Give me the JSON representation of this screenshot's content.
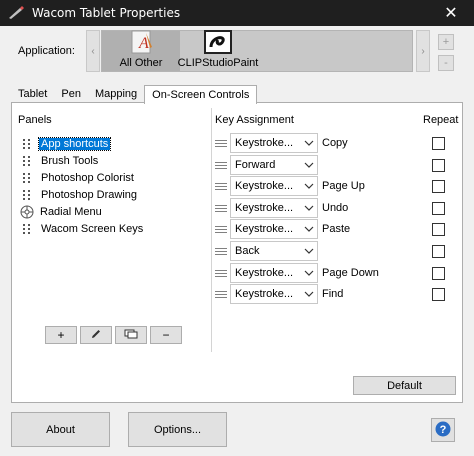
{
  "window": {
    "title": "Wacom Tablet Properties",
    "close_glyph": "✕"
  },
  "application": {
    "label": "Application:",
    "scroll_left_glyph": "‹",
    "scroll_right_glyph": "›",
    "tiles": [
      {
        "label": "All Other",
        "icon": "all-other-icon"
      },
      {
        "label": "CLIPStudioPaint",
        "icon": "clip-studio-icon"
      }
    ],
    "add_glyph": "+",
    "remove_glyph": "-"
  },
  "tabs": [
    {
      "label": "Tablet"
    },
    {
      "label": "Pen"
    },
    {
      "label": "Mapping"
    },
    {
      "label": "On-Screen Controls",
      "active": true
    }
  ],
  "panels": {
    "title": "Panels",
    "items": [
      {
        "label": "App shortcuts",
        "selected": true
      },
      {
        "label": "Brush Tools"
      },
      {
        "label": "Photoshop Colorist"
      },
      {
        "label": "Photoshop Drawing"
      },
      {
        "label": "Radial Menu",
        "icon": "radial-menu-icon"
      },
      {
        "label": "Wacom Screen Keys"
      }
    ],
    "toolbar": {
      "add": "+",
      "remove": "−"
    }
  },
  "key_assignment": {
    "title": "Key Assignment",
    "repeat_title": "Repeat",
    "rows": [
      {
        "type": "Keystroke...",
        "value": "Copy",
        "repeat": false
      },
      {
        "type": "Forward",
        "value": "",
        "repeat": false
      },
      {
        "type": "Keystroke...",
        "value": "Page Up",
        "repeat": false
      },
      {
        "type": "Keystroke...",
        "value": "Undo",
        "repeat": false
      },
      {
        "type": "Keystroke...",
        "value": "Paste",
        "repeat": false
      },
      {
        "type": "Back",
        "value": "",
        "repeat": false
      },
      {
        "type": "Keystroke...",
        "value": "Page Down",
        "repeat": false
      },
      {
        "type": "Keystroke...",
        "value": "Find",
        "repeat": false
      }
    ],
    "default_label": "Default"
  },
  "footer": {
    "about_label": "About",
    "options_label": "Options...",
    "help_glyph": "?"
  },
  "colors": {
    "selection": "#0078d7",
    "titlebar": "#1f1f1f",
    "help": "#2a6cc4"
  }
}
